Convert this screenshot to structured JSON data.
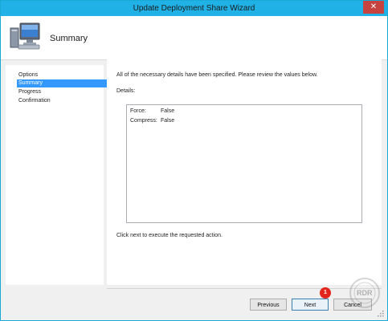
{
  "window": {
    "title": "Update Deployment Share Wizard",
    "close_glyph": "✕"
  },
  "header": {
    "icon": "computer-icon",
    "title": "Summary"
  },
  "nav": {
    "items": [
      {
        "label": "Options",
        "selected": false
      },
      {
        "label": "Summary",
        "selected": true
      },
      {
        "label": "Progress",
        "selected": false
      },
      {
        "label": "Confirmation",
        "selected": false
      }
    ]
  },
  "content": {
    "lead": "All of the necessary details have been specified.  Please review the values below.",
    "details_label": "Details:",
    "details": [
      {
        "key": "Force:",
        "value": "False"
      },
      {
        "key": "Compress:",
        "value": "False"
      }
    ],
    "footer_note": "Click next to execute the requested action."
  },
  "buttons": {
    "previous": "Previous",
    "next": "Next",
    "cancel": "Cancel"
  },
  "annotation": {
    "badge": "1",
    "color": "#e3261b"
  },
  "watermark": {
    "icon": "rdr-logo-icon",
    "text": "RDR"
  },
  "colors": {
    "titlebar": "#20b2e6",
    "selected": "#3399ff"
  }
}
